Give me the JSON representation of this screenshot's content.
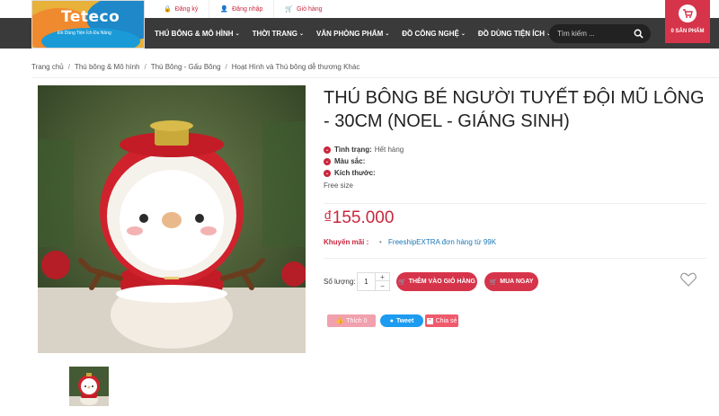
{
  "topbar": {
    "links": [
      {
        "label": "Đăng ký",
        "icon": "lock-icon"
      },
      {
        "label": "Đăng nhập",
        "icon": "user-icon"
      },
      {
        "label": "Giỏ hàng",
        "icon": "cart-icon"
      }
    ]
  },
  "logo": {
    "text": "Teteco",
    "tagline": "Đồ Dùng Tiện Ích Đa Năng"
  },
  "nav": {
    "items": [
      {
        "label": "THÚ BÔNG & MÔ HÌNH"
      },
      {
        "label": "THỜI TRANG"
      },
      {
        "label": "VĂN PHÒNG PHẨM"
      },
      {
        "label": "ĐỒ CÔNG NGHỆ"
      },
      {
        "label": "ĐỒ DÙNG TIỆN ÍCH"
      }
    ],
    "search_placeholder": "Tìm kiếm ...",
    "cart_label": "0 SẢN PHẨM"
  },
  "breadcrumb": [
    "Trang chủ",
    "Thú bông & Mô hình",
    "Thú Bông - Gấu Bông",
    "Hoạt Hình và Thú bông dễ thương Khác"
  ],
  "product": {
    "title": "THÚ BÔNG BÉ NGƯỜI TUYẾT ĐỘI MŨ LÔNG - 30CM (NOEL - GIÁNG SINH)",
    "status_label": "Tình trạng:",
    "status_value": "Hết hàng",
    "color_label": "Màu sắc:",
    "size_label": "Kích thước:",
    "size_value": "Free size",
    "price": "₫155.000",
    "promo_label": "Khuyến mãi :",
    "promo_bullet": "•",
    "promo_text": "FreeshipEXTRA đơn hàng từ 99K",
    "qty_label": "Số lượng:",
    "qty_value": "1",
    "qty_plus": "+",
    "qty_minus": "−",
    "add_to_cart": "THÊM VÀO GIỎ HÀNG",
    "buy_now": "MUA NGAY"
  },
  "social": {
    "like": "Thích 0",
    "tweet": "Tweet",
    "share": "Chia sẻ"
  },
  "colors": {
    "accent": "#d6344a",
    "nav_bg": "#3a3a3a",
    "link": "#1a77b8"
  }
}
